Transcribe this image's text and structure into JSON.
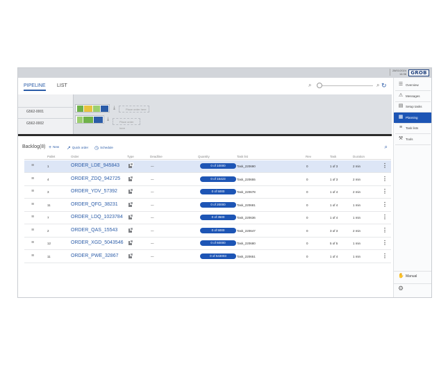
{
  "header": {
    "date": "28/01/2024",
    "time": "14:36",
    "logo_text": "GROB"
  },
  "tabs": [
    {
      "label": "PIPELINE",
      "active": true
    },
    {
      "label": "LIST",
      "active": false
    }
  ],
  "pipeline": {
    "lanes": [
      {
        "id": "G562-0001",
        "placeholder": "Place order here"
      },
      {
        "id": "G562-0002",
        "placeholder": "Place order here"
      }
    ]
  },
  "backlog": {
    "title": "Backlog(8)",
    "actions": {
      "new": "New",
      "quick_order": "Quick order",
      "schedule": "Schedule"
    },
    "columns": [
      "Pallet",
      "Order",
      "Type",
      "Deadline",
      "Quantity",
      "Task list",
      "Rev",
      "Task",
      "Duration"
    ],
    "rows": [
      {
        "pallet": "1",
        "order": "ORDER_LDE_945843",
        "deadline": "—",
        "quantity": "0 of 10000",
        "task_list": "Task_220690",
        "rev": "0",
        "task": "1 of 3",
        "duration": "2 min",
        "selected": true
      },
      {
        "pallet": "4",
        "order": "ORDER_ZDQ_942725",
        "deadline": "—",
        "quantity": "0 of 15423",
        "task_list": "Task_220655",
        "rev": "0",
        "task": "1 of 3",
        "duration": "2 min",
        "selected": false
      },
      {
        "pallet": "3",
        "order": "ORDER_YDV_57392",
        "deadline": "—",
        "quantity": "0 of 5000",
        "task_list": "Task_220678",
        "rev": "0",
        "task": "1 of 4",
        "duration": "2 min",
        "selected": false
      },
      {
        "pallet": "11",
        "order": "ORDER_QFG_38231",
        "deadline": "—",
        "quantity": "0 of 20000",
        "task_list": "Task_220681",
        "rev": "0",
        "task": "1 of 4",
        "duration": "1 min",
        "selected": false
      },
      {
        "pallet": "7",
        "order": "ORDER_LDQ_1023784",
        "deadline": "—",
        "quantity": "0 of 3500",
        "task_list": "Task_220636",
        "rev": "0",
        "task": "1 of 4",
        "duration": "1 min",
        "selected": false
      },
      {
        "pallet": "2",
        "order": "ORDER_QAS_15543",
        "deadline": "—",
        "quantity": "0 of 5000",
        "task_list": "Task_220647",
        "rev": "0",
        "task": "3 of 3",
        "duration": "2 min",
        "selected": false
      },
      {
        "pallet": "12",
        "order": "ORDER_XGD_5043546",
        "deadline": "—",
        "quantity": "0 of 60000",
        "task_list": "Task_220680",
        "rev": "0",
        "task": "5 of 5",
        "duration": "1 min",
        "selected": false
      },
      {
        "pallet": "11",
        "order": "ORDER_PWE_32867",
        "deadline": "—",
        "quantity": "0 of 543003",
        "task_list": "Task_220651",
        "rev": "0",
        "task": "1 of 4",
        "duration": "1 min",
        "selected": false
      }
    ]
  },
  "nav": {
    "items": [
      {
        "label": "Overview",
        "icon": "overview-icon",
        "glyph": "☰",
        "active": false
      },
      {
        "label": "Messages",
        "icon": "warning-icon",
        "glyph": "⚠",
        "active": false
      },
      {
        "label": "Setup tasks",
        "icon": "folder-icon",
        "glyph": "▤",
        "active": false
      },
      {
        "label": "Planning",
        "icon": "planning-icon",
        "glyph": "▦",
        "active": true
      },
      {
        "label": "Task lists",
        "icon": "task-list-icon",
        "glyph": "≡",
        "active": false
      },
      {
        "label": "Tools",
        "icon": "tools-icon",
        "glyph": "⚒",
        "active": false
      }
    ],
    "manual": "Manual"
  },
  "colors": {
    "accent": "#1d55b5",
    "link": "#2b5ca8",
    "selected_row": "#dde6f6"
  }
}
